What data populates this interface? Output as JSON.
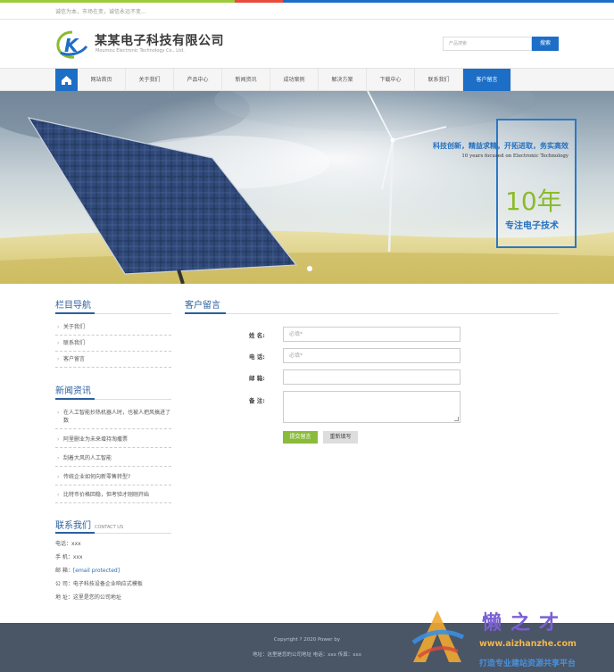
{
  "colors": {
    "brand_blue": "#1d6ec6",
    "title_blue": "#2b5f9e",
    "green": "#8bbb3a",
    "footer_bg": "#4a5566",
    "strip": [
      "#9ccb3b",
      "#e74c3c",
      "#1d6ec6"
    ]
  },
  "topbar": {
    "slogan": "诚信为本，市场在变，诚信永远不变..."
  },
  "header": {
    "logo_icon": "k-logo-icon",
    "company_cn": "某某电子科技有限公司",
    "company_en": "Moumou Electronic Technology Co., Ltd.",
    "search_placeholder": "产品搜索",
    "search_button": "搜索"
  },
  "nav": {
    "home_icon": "home-icon",
    "items": [
      {
        "label": "网站首页"
      },
      {
        "label": "关于我们"
      },
      {
        "label": "产品中心"
      },
      {
        "label": "新闻资讯"
      },
      {
        "label": "成功案例"
      },
      {
        "label": "解决方案"
      },
      {
        "label": "下载中心"
      },
      {
        "label": "联系我们"
      },
      {
        "label": "客户留言"
      }
    ],
    "active_index": 8
  },
  "banner": {
    "tagline": "科技创新，精益求精，开拓进取，务实高效",
    "tagline_en": "10 years focused on Electronic Technology",
    "year_text": "10年",
    "subtitle": "专注电子技术"
  },
  "sidebar": {
    "nav_title": "栏目导航",
    "nav_items": [
      {
        "label": "关于我们"
      },
      {
        "label": "联系我们"
      },
      {
        "label": "客户留言"
      }
    ],
    "news_title": "新闻资讯",
    "news_items": [
      {
        "label": "在人工智能抄热机器人时，也被人把风搞进了数"
      },
      {
        "label": "阿里删业为未来增持淘撒票"
      },
      {
        "label": "刮着大风的人工智能"
      },
      {
        "label": "传统企业如何向新零售转型?"
      },
      {
        "label": "比特币价格回稳，但考验才刚刚开始"
      }
    ],
    "contact_title": "联系我们",
    "contact_sub": "CONTACT US",
    "contact_lines": [
      {
        "label": "电话：",
        "value": "xxx"
      },
      {
        "label": "手 机：",
        "value": "xxx"
      },
      {
        "label": "邮 箱：",
        "value": "[email protected]"
      },
      {
        "label": "公 司：",
        "value": "电子科技设备企业响应式模板"
      },
      {
        "label": "地 址：",
        "value": "这里是您的公司地址"
      }
    ]
  },
  "main": {
    "title": "客户留言",
    "form": {
      "name_label": "姓 名:",
      "name_placeholder": "必填*",
      "phone_label": "电 话:",
      "phone_placeholder": "必填*",
      "email_label": "邮 箱:",
      "email_placeholder": "",
      "note_label": "备 注:",
      "submit": "提交留言",
      "reset": "重新填写"
    }
  },
  "footer": {
    "copyright": "Copyright ? 2020 Power by",
    "address": "地址：这里是您的公司地址  电话：xxx  传真：xxx"
  },
  "watermark": {
    "title": "懒之才",
    "url": "www.aizhanzhe.com",
    "tagline": "打造专业建站资源共享平台"
  }
}
